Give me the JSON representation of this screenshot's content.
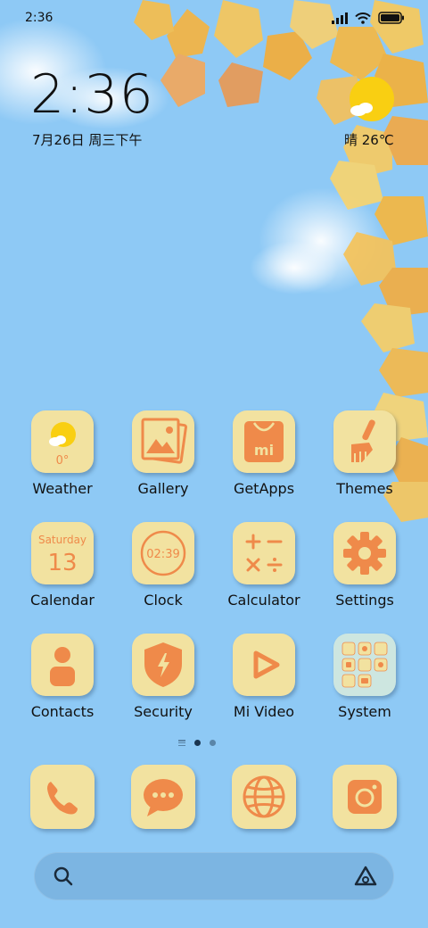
{
  "status_bar": {
    "time": "2:36"
  },
  "clock_widget": {
    "time": "2:36",
    "date": "7月26日 周三下午"
  },
  "weather_widget": {
    "condition_temp": "晴 26℃"
  },
  "apps": [
    {
      "label": "Weather",
      "icon": "weather-icon",
      "temp": "0°"
    },
    {
      "label": "Gallery",
      "icon": "gallery-icon"
    },
    {
      "label": "GetApps",
      "icon": "getapps-icon"
    },
    {
      "label": "Themes",
      "icon": "themes-icon"
    },
    {
      "label": "Calendar",
      "icon": "calendar-icon",
      "weekday": "Saturday",
      "day": "13"
    },
    {
      "label": "Clock",
      "icon": "clock-icon",
      "time": "02:39"
    },
    {
      "label": "Calculator",
      "icon": "calculator-icon"
    },
    {
      "label": "Settings",
      "icon": "settings-icon"
    },
    {
      "label": "Contacts",
      "icon": "contacts-icon"
    },
    {
      "label": "Security",
      "icon": "security-icon"
    },
    {
      "label": "Mi Video",
      "icon": "mi-video-icon"
    },
    {
      "label": "System",
      "icon": "system-folder-icon"
    }
  ],
  "dock": [
    {
      "icon": "phone-icon"
    },
    {
      "icon": "messages-icon"
    },
    {
      "icon": "browser-icon"
    },
    {
      "icon": "camera-icon"
    }
  ],
  "colors": {
    "background": "#8ec9f5",
    "tile": "#f2e2a0",
    "accent": "#ef8a4a",
    "sun": "#f9cf12"
  }
}
